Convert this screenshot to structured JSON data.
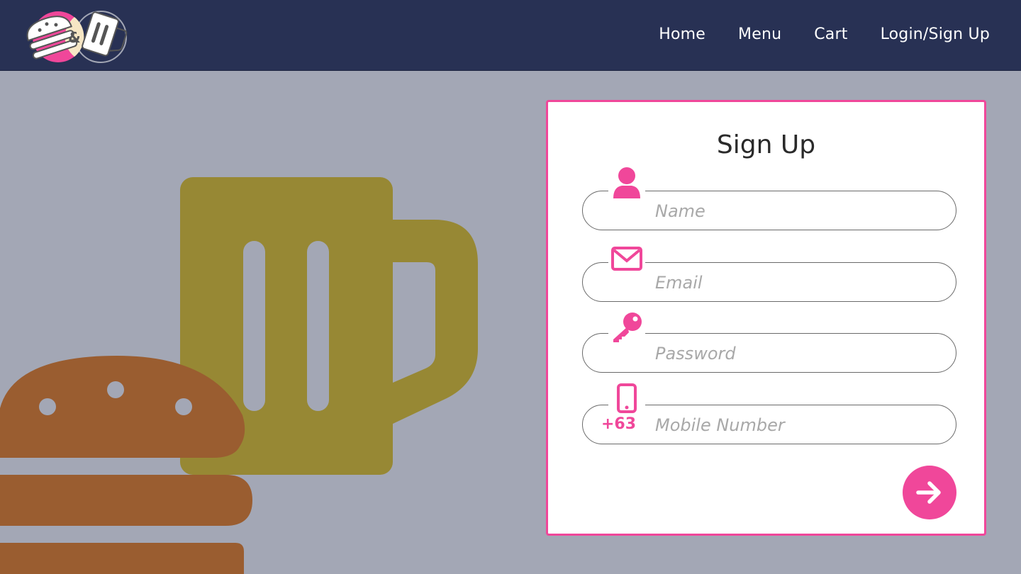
{
  "colors": {
    "nav_bg": "#283154",
    "page_bg": "#a3a7b5",
    "accent": "#f0479a",
    "burger": "#9a5d30",
    "mug": "#978834"
  },
  "logo": {
    "ampersand": "&",
    "icon": "burger-and-beer-logo"
  },
  "nav": {
    "items": [
      {
        "label": "Home"
      },
      {
        "label": "Menu"
      },
      {
        "label": "Cart"
      },
      {
        "label": "Login/Sign Up"
      }
    ]
  },
  "signup": {
    "title": "Sign Up",
    "fields": [
      {
        "icon": "user-icon",
        "placeholder": "Name",
        "value": ""
      },
      {
        "icon": "envelope-icon",
        "placeholder": "Email",
        "value": ""
      },
      {
        "icon": "key-icon",
        "placeholder": "Password",
        "value": ""
      },
      {
        "icon": "phone-icon",
        "placeholder": "Mobile Number",
        "value": "",
        "prefix": "+63"
      }
    ],
    "submit_icon": "arrow-right-icon"
  }
}
